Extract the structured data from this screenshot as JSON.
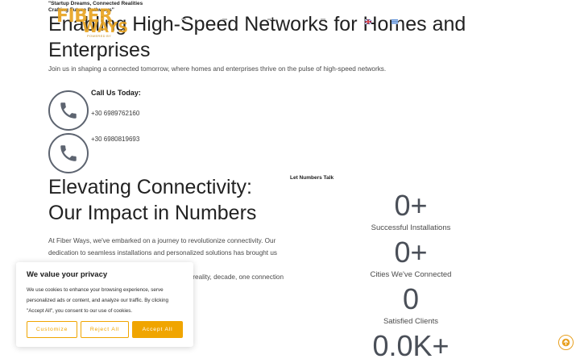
{
  "header": {
    "tagline_line1": "\"Startup Dreams, Connected Realities",
    "tagline_line2": "Crafting Future Pathways\"",
    "logo_text_1": "FIBER",
    "logo_text_2": "WAYS",
    "logo_subtext": "POWERED BY",
    "brand_color": "#e8a422"
  },
  "hero": {
    "title": "Enabling High-Speed Networks for Homes and Enterprises",
    "subtitle": "Join us in shaping a connected tomorrow, where homes and enterprises thrive on the pulse of high-speed networks."
  },
  "contact": {
    "title": "Call Us Today:",
    "phone_1": "+30 6989762160",
    "phone_2": "+30 6980819693"
  },
  "impact": {
    "title": "Elevating Connectivity: Our Impact in Numbers",
    "body_line1": "At Fiber Ways, we've embarked on a journey to revolutionize connectivity. Our",
    "body_line2": "dedication to seamless installations and personalized solutions has brought us closer",
    "body_line3": "to making our vision of connected communities a reality, decade, one connection at a time."
  },
  "stats": {
    "heading": "Let Numbers Talk",
    "items": [
      {
        "value": "0+",
        "label": "Successful Installations"
      },
      {
        "value": "0+",
        "label": "Cities We've Connected"
      },
      {
        "value": "0",
        "label": "Satisfied Clients"
      },
      {
        "value": "0.0K+",
        "label": ""
      }
    ]
  },
  "cookie": {
    "title": "We value your privacy",
    "body": "We use cookies to enhance your browsing experience, serve personalized ads or content, and analyze our traffic. By clicking \"Accept All\", you consent to our use of cookies.",
    "customize": "Customize",
    "reject": "Reject All",
    "accept": "Accept All",
    "accent": "#f0a500"
  },
  "icons": {
    "phone": "phone-icon",
    "scroll_top": "arrow-up-icon"
  }
}
